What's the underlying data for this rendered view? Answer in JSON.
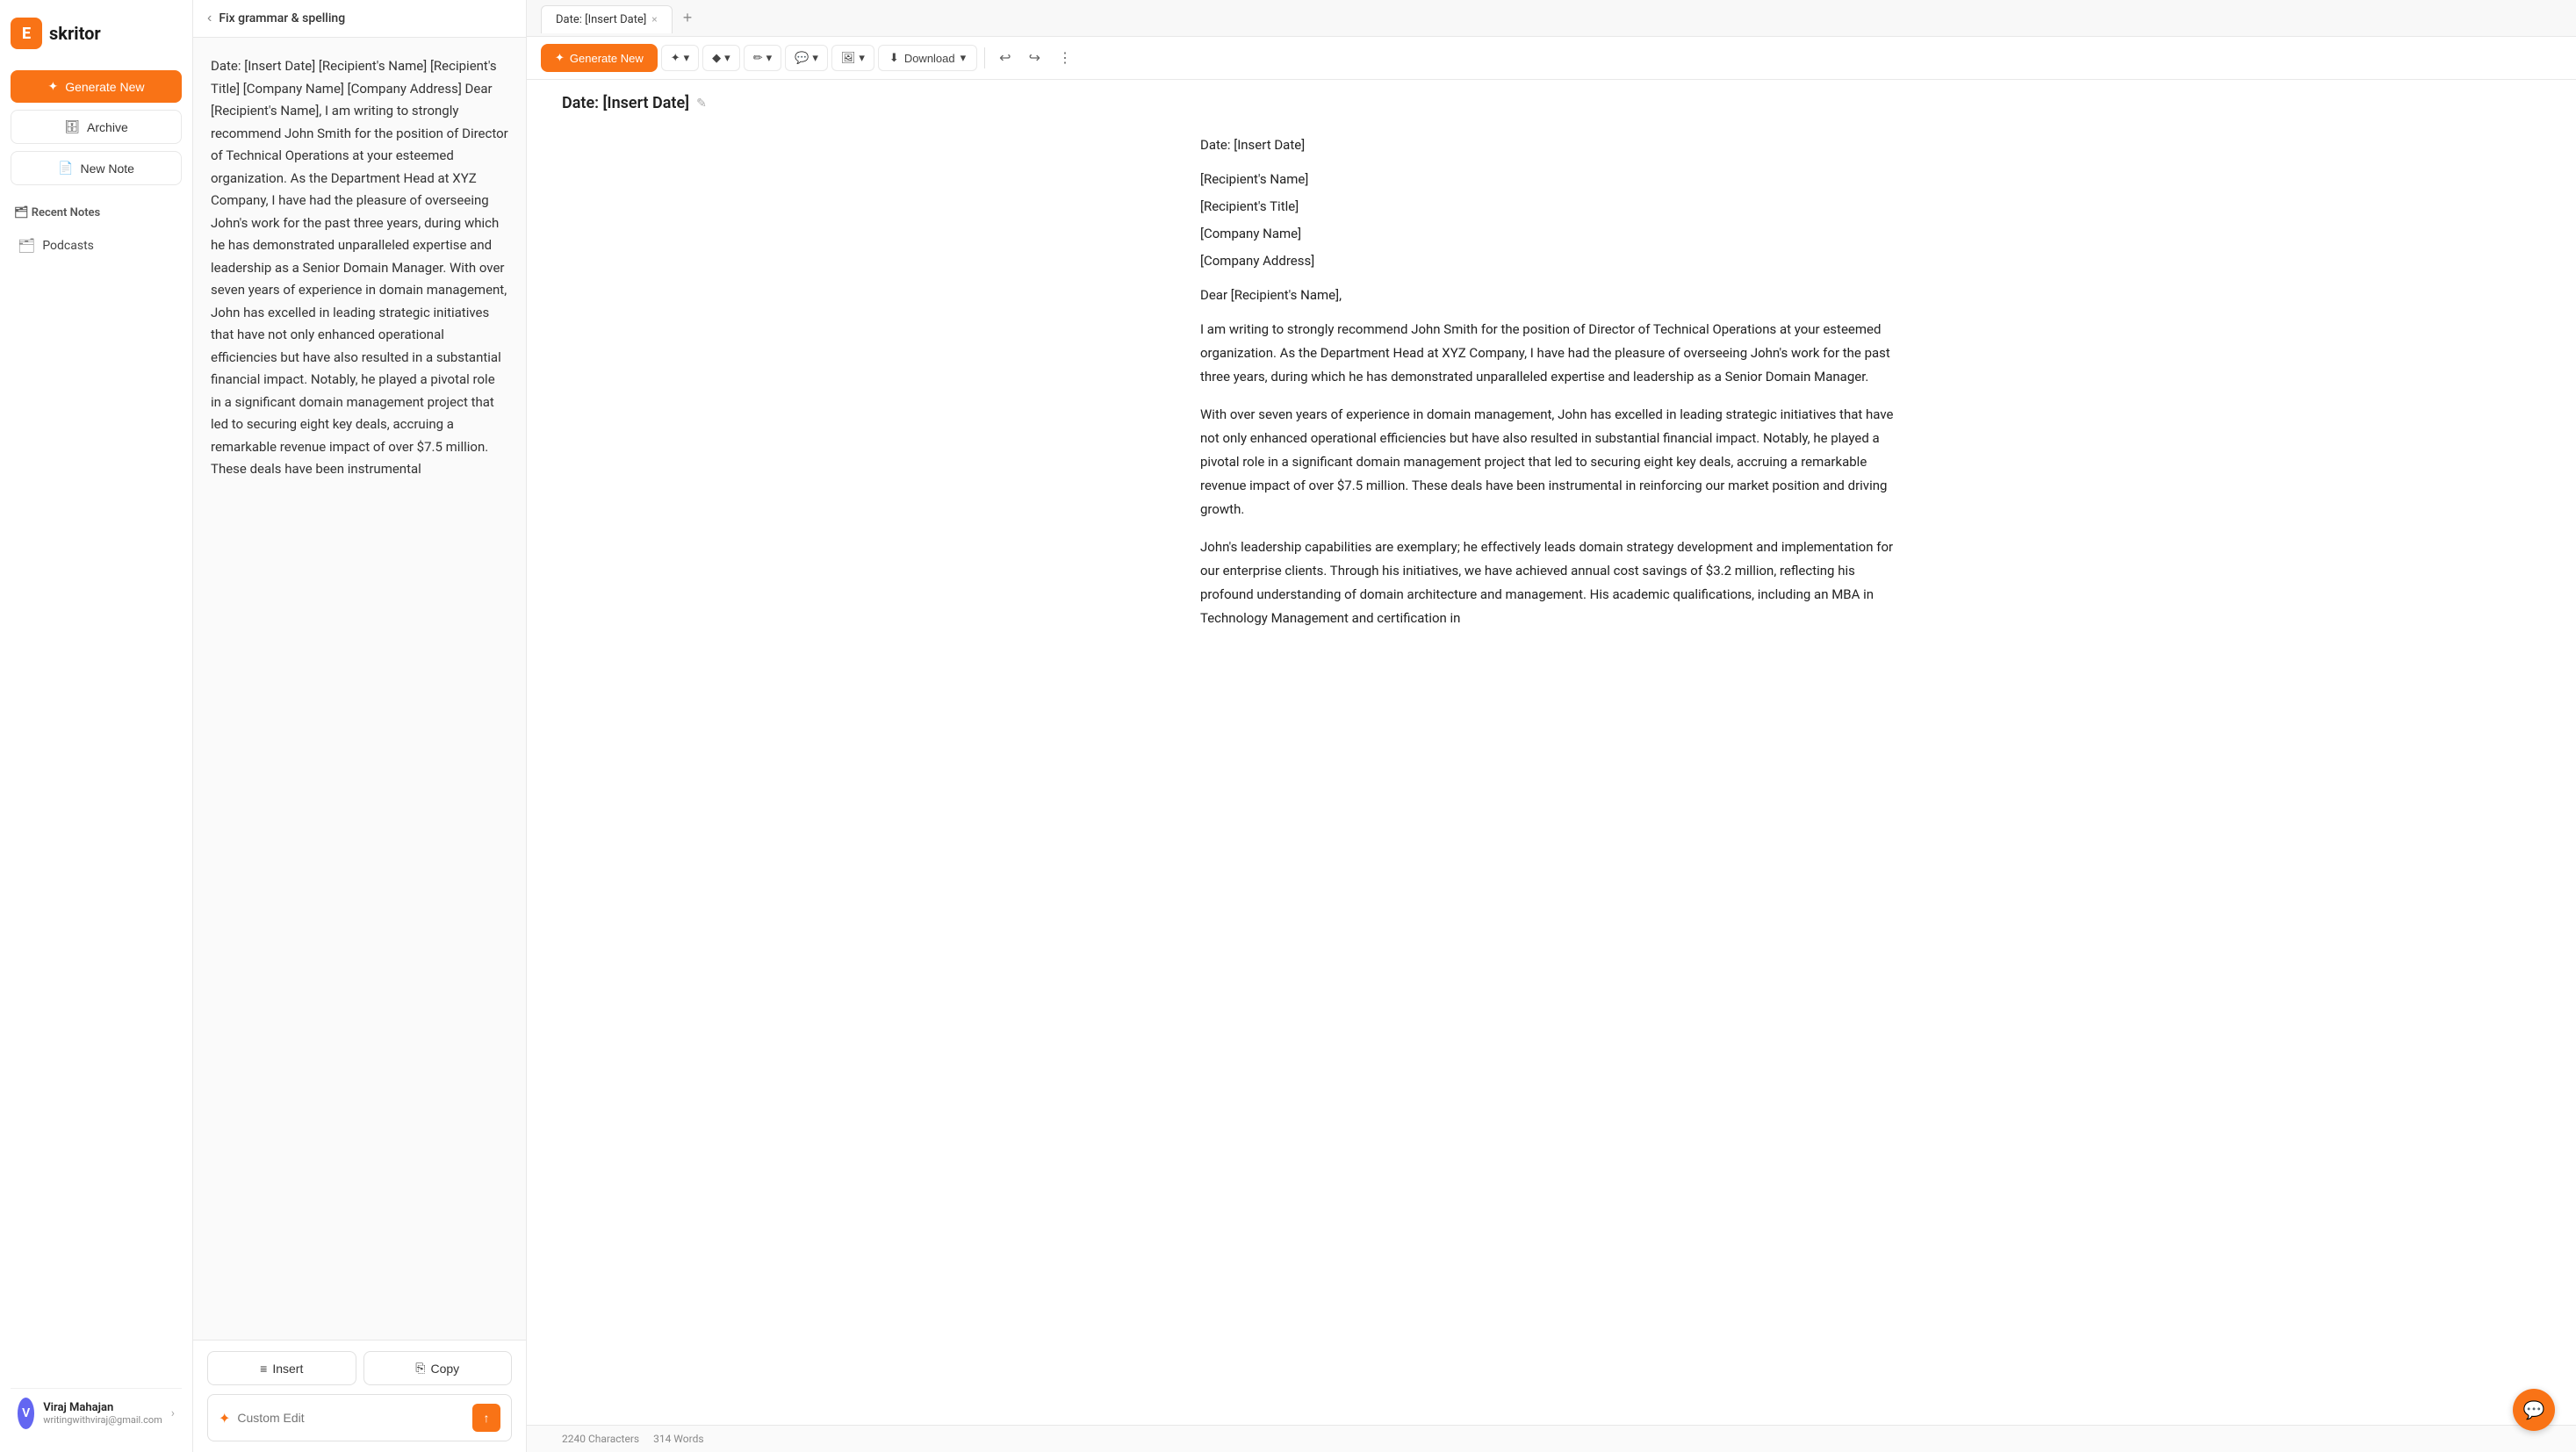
{
  "logo": {
    "icon_letter": "E",
    "text": "skritor"
  },
  "sidebar": {
    "generate_new_label": "Generate New",
    "archive_label": "Archive",
    "new_note_label": "New Note",
    "recent_notes_label": "Recent Notes",
    "podcasts_label": "Podcasts"
  },
  "user": {
    "initial": "V",
    "name": "Viraj Mahajan",
    "email": "writingwithviraj@gmail.com"
  },
  "middle_panel": {
    "header_title": "Fix grammar & spelling",
    "preview_text": "Date: [Insert Date] [Recipient's Name] [Recipient's Title] [Company Name] [Company Address] Dear [Recipient's Name], I am writing to strongly recommend John Smith for the position of Director of Technical Operations at your esteemed organization. As the Department Head at XYZ Company, I have had the pleasure of overseeing John's work for the past three years, during which he has demonstrated unparalleled expertise and leadership as a Senior Domain Manager. With over seven years of experience in domain management, John has excelled in leading strategic initiatives that have not only enhanced operational efficiencies but have also resulted in a substantial financial impact. Notably, he played a pivotal role in a significant domain management project that led to securing eight key deals, accruing a remarkable revenue impact of over $7.5 million. These deals have been instrumental",
    "insert_label": "Insert",
    "copy_label": "Copy",
    "custom_edit_placeholder": "Custom Edit",
    "send_icon": "↑"
  },
  "tab_bar": {
    "tab_label": "Date: [Insert Date]",
    "close_icon": "×",
    "plus_icon": "+"
  },
  "toolbar": {
    "generate_new_label": "Generate New",
    "download_label": "Download",
    "undo_icon": "↩",
    "redo_icon": "↪",
    "star_icon": "✦",
    "diamond_icon": "◆",
    "brush_icon": "🖌",
    "comment_icon": "💬",
    "image_icon": "🖼",
    "chevron_down": "▾"
  },
  "document": {
    "title": "Date: [Insert Date]",
    "edit_icon": "✎",
    "lines": [
      "Date: [Insert Date]",
      "[Recipient's Name]",
      "[Recipient's Title]",
      "[Company Name]",
      "[Company Address]",
      "Dear [Recipient's Name],"
    ],
    "paragraphs": [
      "I am writing to strongly recommend John Smith for the position of Director of Technical Operations at your esteemed organization. As the Department Head at XYZ Company, I have had the pleasure of overseeing John's work for the past three years, during which he has demonstrated unparalleled expertise and leadership as a Senior Domain Manager.",
      "With over seven years of experience in domain management, John has excelled in leading strategic initiatives that have not only enhanced operational efficiencies but have also resulted in substantial financial impact. Notably, he played a pivotal role in a significant domain management project that led to securing eight key deals, accruing a remarkable revenue impact of over $7.5 million. These deals have been instrumental in reinforcing our market position and driving growth.",
      "John's leadership capabilities are exemplary; he effectively leads domain strategy development and implementation for our enterprise clients. Through his initiatives, we have achieved annual cost savings of $3.2 million, reflecting his profound understanding of domain architecture and management. His academic qualifications, including an MBA in Technology Management and certification in"
    ]
  },
  "status_bar": {
    "characters_label": "2240 Characters",
    "words_label": "314 Words"
  }
}
